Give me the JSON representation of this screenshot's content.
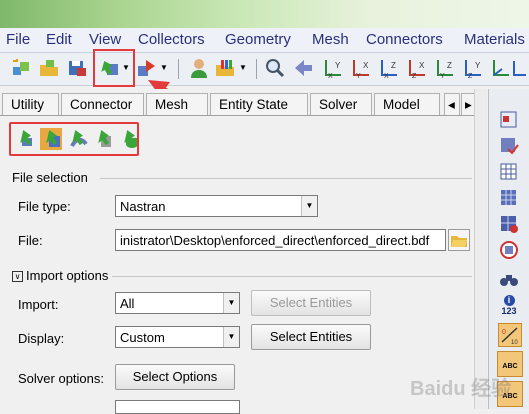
{
  "menu": [
    "File",
    "Edit",
    "View",
    "Collectors",
    "Geometry",
    "Mesh",
    "Connectors",
    "Materials"
  ],
  "toolbar_icons": [
    "new-model-icon",
    "open-model-icon",
    "save-model-icon",
    "import-icon",
    "export-icon",
    "user-profile-icon",
    "color-mode-icon",
    "zoom-icon",
    "previous-view-icon",
    "axis-xy-icon",
    "axis-yx-icon",
    "axis-xz-icon",
    "axis-zx-icon",
    "axis-yz-icon",
    "axis-zy-icon",
    "axis-iso-icon"
  ],
  "tabs": [
    "Utility",
    "Connector",
    "Mesh",
    "Entity State",
    "Solver",
    "Model"
  ],
  "tab_nav": [
    "◂",
    "▸"
  ],
  "import_type_icons": [
    "import-model-icon",
    "import-geometry-icon",
    "import-connectors-icon",
    "import-fe-overlay-icon",
    "import-solver-deck-icon"
  ],
  "file_selection": {
    "heading": "File selection",
    "file_type_label": "File type:",
    "file_type_value": "Nastran",
    "file_label": "File:",
    "file_value": "inistrator\\Desktop\\enforced_direct\\enforced_direct.bdf"
  },
  "import_options": {
    "heading": "Import options",
    "import_label": "Import:",
    "import_value": "All",
    "select_entities_1": "Select Entities",
    "display_label": "Display:",
    "display_value": "Custom",
    "select_entities_2": "Select Entities",
    "solver_options_label": "Solver options:",
    "select_options": "Select Options"
  },
  "right_icons": [
    "select-icon",
    "mask-icon",
    "table-icon",
    "grid-icon",
    "grid2-icon",
    "find-icon",
    "binoculars-icon",
    "info-123-icon",
    "measure-icon",
    "abc-up-icon",
    "abc-down-icon"
  ],
  "rb_texts": [
    "123",
    "ABC",
    "ABC"
  ],
  "watermark": "Baidu 经验",
  "colors": {
    "accent_red": "#e33b3b",
    "menu_text": "#2a2f7a",
    "banner_green": "#a9d48f"
  }
}
